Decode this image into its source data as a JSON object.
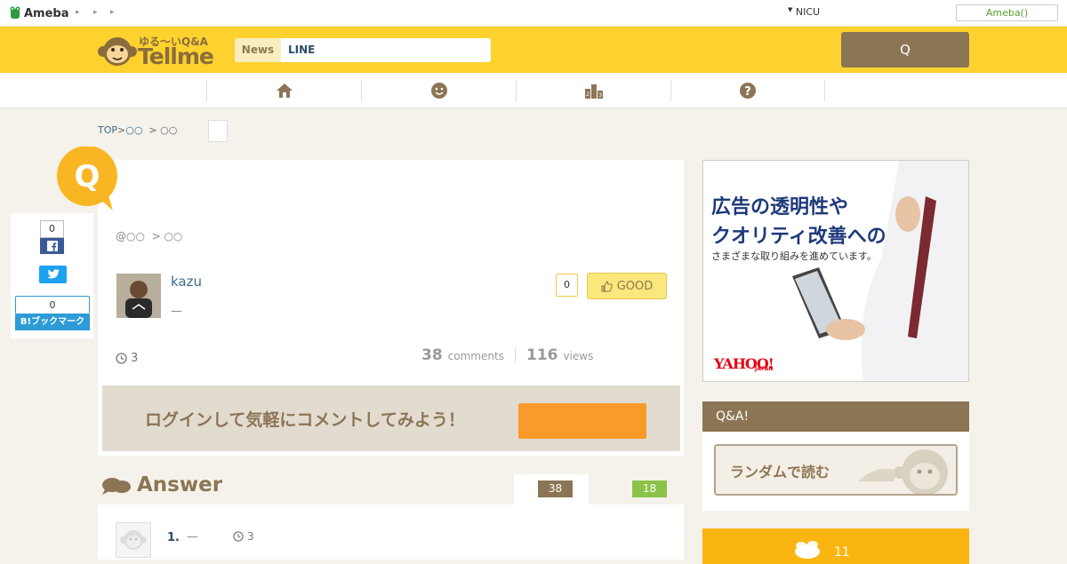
{
  "topbar": {
    "brand": "Ameba",
    "notice": "NICU",
    "login_label": "Ameba()"
  },
  "header": {
    "logo_sub": "ゆる〜いQ&A",
    "logo_main": "Tellme",
    "news_tab": "News",
    "line_tab": "LINE",
    "ask_label": "Q"
  },
  "nav": {
    "items": [
      {
        "icon": "home-icon"
      },
      {
        "icon": "smile-icon"
      },
      {
        "icon": "ranking-icon"
      },
      {
        "icon": "question-icon"
      }
    ]
  },
  "breadcrumb": {
    "top": "TOP",
    "sep1": " > ",
    "cat1": "○○",
    "sep2": "  > ",
    "cat2": "○○"
  },
  "question": {
    "badge": "Q",
    "asker_prefix": "@○○",
    "asker_sep": "  > ○○",
    "username": "kazu",
    "user_subtitle": "—",
    "good_count": "0",
    "good_label": "GOOD",
    "time_ago": "3",
    "comments_count": "38",
    "comments_label": "comments",
    "views_count": "116",
    "views_label": "views"
  },
  "login_prompt": {
    "text": "ログインして気軽にコメントしてみよう！"
  },
  "share": {
    "facebook_count": "0",
    "hatena_count": "0",
    "hatena_label": "B!ブックマーク"
  },
  "answers": {
    "title": "Answer",
    "tab_all_count": "38",
    "tab_other_count": "18",
    "first": {
      "number": "1.",
      "dash": "—",
      "time_ago": "3"
    }
  },
  "ad": {
    "line1": "広告の透明性や",
    "line2": "クオリティ改善への",
    "line3": "さまざまな取り組みを進めています。",
    "brand": "YAHOO!",
    "brand_sub": "JAPAN"
  },
  "sidebar": {
    "qa_title": "Q&A!",
    "random_label": "ランダムで読む",
    "promo_count": "11"
  },
  "colors": {
    "header_yellow": "#fdd22f",
    "brown": "#8c7555",
    "orange": "#fa9a2a",
    "green": "#8bc34a"
  }
}
